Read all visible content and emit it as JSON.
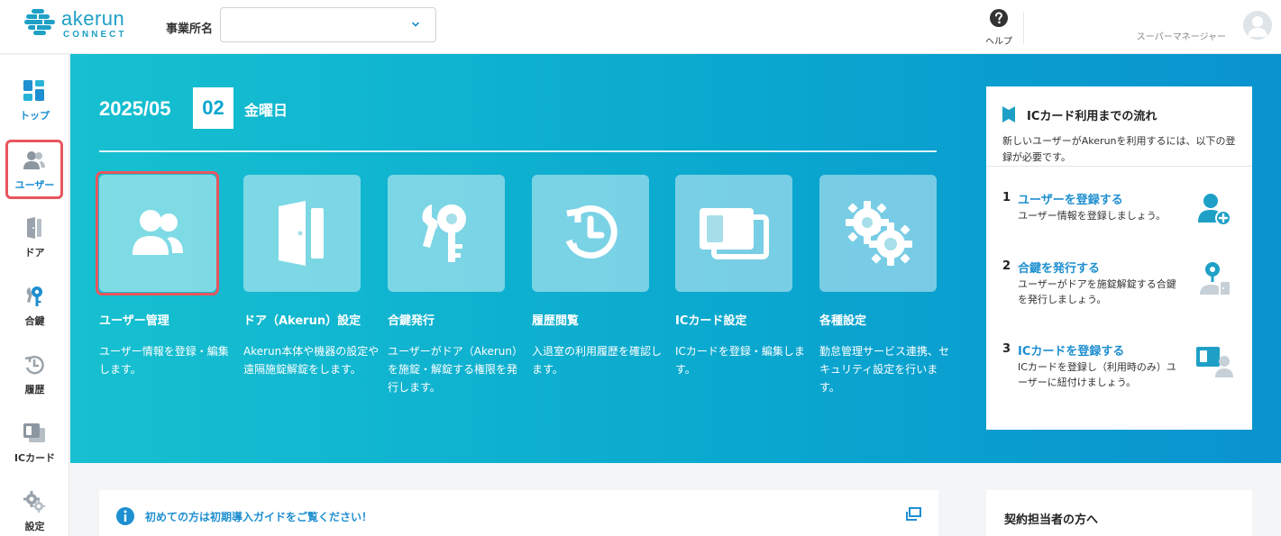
{
  "header": {
    "logo_name": "akerun",
    "logo_sub": "CONNECT",
    "office_label": "事業所名",
    "office_value": "",
    "help_label": "ヘルプ",
    "user_name": "",
    "user_role": "スーパーマネージャー"
  },
  "sidebar": {
    "items": [
      {
        "label": "トップ",
        "icon": "dashboard-icon"
      },
      {
        "label": "ユーザー",
        "icon": "users-icon",
        "active": true
      },
      {
        "label": "ドア",
        "icon": "door-icon"
      },
      {
        "label": "合鍵",
        "icon": "keys-icon"
      },
      {
        "label": "履歴",
        "icon": "history-icon"
      },
      {
        "label": "ICカード",
        "icon": "ic-card-icon"
      },
      {
        "label": "設定",
        "icon": "gear-icon"
      }
    ]
  },
  "hero": {
    "date_year_month": "2025/05",
    "date_day": "02",
    "date_weekday": "金曜日",
    "tiles": [
      {
        "title": "ユーザー管理",
        "desc": "ユーザー情報を登録・編集します。",
        "icon": "users-icon"
      },
      {
        "title": "ドア（Akerun）設定",
        "desc": "Akerun本体や機器の設定や遠隔施錠解錠をします。",
        "icon": "door-icon"
      },
      {
        "title": "合鍵発行",
        "desc": "ユーザーがドア（Akerun）を施錠・解錠する権限を発行します。",
        "icon": "keys-icon"
      },
      {
        "title": "履歴閲覧",
        "desc": "入退室の利用履歴を確認します。",
        "icon": "history-icon"
      },
      {
        "title": "ICカード設定",
        "desc": "ICカードを登録・編集します。",
        "icon": "ic-card-icon"
      },
      {
        "title": "各種設定",
        "desc": "勤怠管理サービス連携、セキュリティ設定を行います。",
        "icon": "gear-icon"
      }
    ]
  },
  "ic_panel": {
    "title": "ICカード利用までの流れ",
    "intro": "新しいユーザーがAkerunを利用するには、以下の登録が必要です。",
    "steps": [
      {
        "num": "1",
        "link": "ユーザーを登録する",
        "desc": "ユーザー情報を登録しましょう。"
      },
      {
        "num": "2",
        "link": "合鍵を発行する",
        "desc": "ユーザーがドアを施錠解錠する合鍵を発行しましょう。"
      },
      {
        "num": "3",
        "link": "ICカードを登録する",
        "desc": "ICカードを登録し（利用時のみ）ユーザーに紐付けましょう。"
      }
    ]
  },
  "bottom": {
    "guide_text": "初めての方は初期導入ガイドをご覧ください！",
    "contract_title": "契約担当者の方へ"
  },
  "colors": {
    "accent": "#1ea0c6",
    "link": "#1e8fd0",
    "highlight": "#e8565e"
  }
}
